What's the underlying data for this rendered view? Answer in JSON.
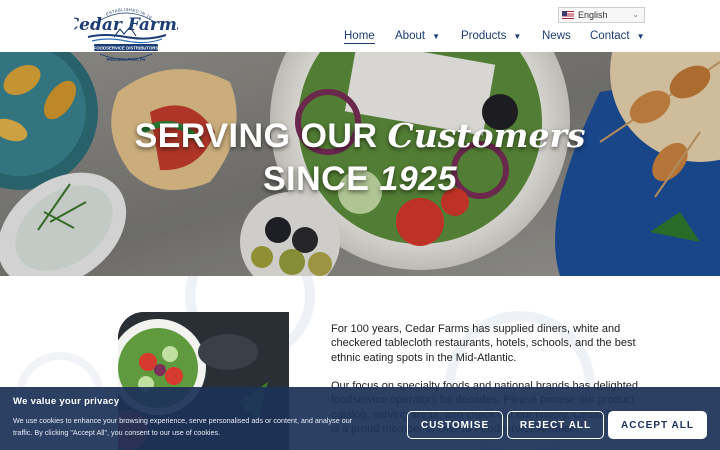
{
  "logo": {
    "established": "ESTABLISHED IN 1925",
    "wordmark": "Cedar Farms",
    "tagline": "FOODSERVICE DISTRIBUTORS",
    "city": "PHILADELPHIA, PA"
  },
  "language": {
    "selected": "English",
    "flag_icon": "us-flag-icon"
  },
  "nav": {
    "items": [
      {
        "label": "Home",
        "active": true,
        "dropdown": false
      },
      {
        "label": "About",
        "active": false,
        "dropdown": true
      },
      {
        "label": "Products",
        "active": false,
        "dropdown": true
      },
      {
        "label": "News",
        "active": false,
        "dropdown": false
      },
      {
        "label": "Contact",
        "active": false,
        "dropdown": true
      }
    ]
  },
  "hero": {
    "line1_a": "SERVING OUR",
    "line1_b": "Customers",
    "line2_a": "SINCE",
    "line2_b": "1925"
  },
  "content": {
    "paragraph1": "For 100 years, Cedar Farms has supplied diners, white and checkered tablecloth restaurants, hotels, schools, and the best ethnic eating spots in the Mid-Atlantic.",
    "paragraph2": "Our focus on specialty foods and national brands has delighted foodservice operators for decades. Please browse our product catalog, serving areas, and check out our history. Cedar Farms is a proud member of UniPro Foodservice Alliance."
  },
  "cookie": {
    "title": "We value your privacy",
    "text": "We use cookies to enhance your browsing experience, serve personalised ads or content, and analyse our traffic. By clicking \"Accept All\", you consent to our use of cookies.",
    "customise": "CUSTOMISE",
    "reject": "REJECT ALL",
    "accept": "ACCEPT ALL"
  },
  "colors": {
    "brand_navy": "#1c3e74",
    "banner_bg": "#1c3158"
  }
}
